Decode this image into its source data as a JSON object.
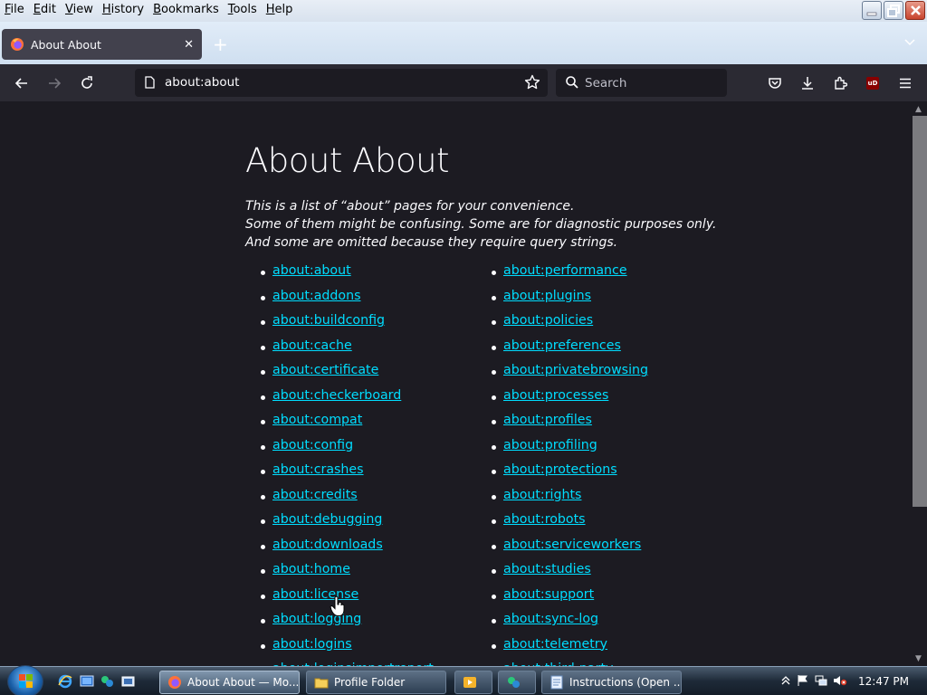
{
  "menu": {
    "items": [
      "File",
      "Edit",
      "View",
      "History",
      "Bookmarks",
      "Tools",
      "Help"
    ]
  },
  "tab": {
    "title": "About About",
    "favicon": "firefox-icon"
  },
  "nav": {
    "url": "about:about",
    "search_placeholder": "Search"
  },
  "page": {
    "heading": "About About",
    "description_lines": [
      "This is a list of “about” pages for your convenience.",
      "Some of them might be confusing. Some are for diagnostic purposes only.",
      "And some are omitted because they require query strings."
    ],
    "links_col1": [
      "about:about",
      "about:addons",
      "about:buildconfig",
      "about:cache",
      "about:certificate",
      "about:checkerboard",
      "about:compat",
      "about:config",
      "about:crashes",
      "about:credits",
      "about:debugging",
      "about:downloads",
      "about:home",
      "about:license",
      "about:logging",
      "about:logins",
      "about:loginsimportreport"
    ],
    "links_col2": [
      "about:performance",
      "about:plugins",
      "about:policies",
      "about:preferences",
      "about:privatebrowsing",
      "about:processes",
      "about:profiles",
      "about:profiling",
      "about:protections",
      "about:rights",
      "about:robots",
      "about:serviceworkers",
      "about:studies",
      "about:support",
      "about:sync-log",
      "about:telemetry",
      "about:third-party"
    ]
  },
  "taskbar": {
    "buttons": [
      "About About — Mo...",
      "Profile Folder",
      "",
      "",
      "Instructions (Open ..."
    ],
    "clock": "12:47 PM"
  },
  "colors": {
    "link": "#00ddff",
    "page_bg": "#1c1b22",
    "toolbar_bg": "#2b2a33",
    "tab_bg": "#42414d"
  }
}
